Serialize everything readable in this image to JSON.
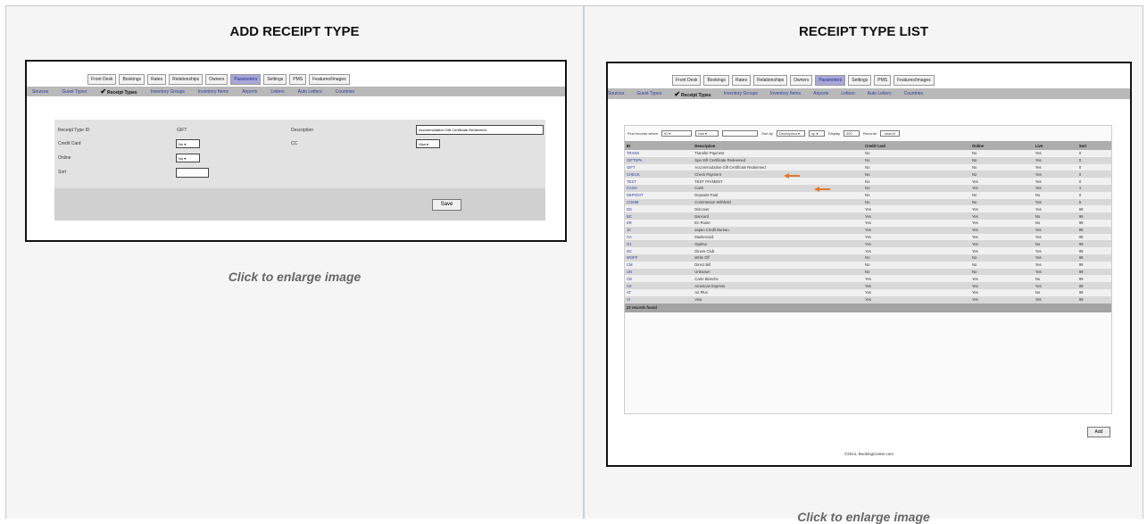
{
  "left": {
    "title": "ADD RECEIPT TYPE",
    "caption": "Click to enlarge image",
    "tabs": [
      "Front Desk",
      "Bookings",
      "Rates",
      "Relationships",
      "Owners",
      "Parameters",
      "Settings",
      "PMS",
      "Features/Images"
    ],
    "active_tab": 5,
    "subnav": [
      "Sources",
      "Guest Types",
      "Receipt Types",
      "Inventory Groups",
      "Inventory Items",
      "Airports",
      "Letters",
      "Auto Letters",
      "Countries"
    ],
    "active_sub": 2,
    "form": {
      "receipt_type_id_label": "Receipt Type ID",
      "receipt_type_id_value": "GIFT",
      "description_label": "Description",
      "description_value": "Accommodation Gift Certificate Redeemed",
      "credit_card_label": "Credit Card",
      "credit_card_value": "No",
      "cc_label": "CC",
      "cc_value": "Visa",
      "online_label": "Online",
      "online_value": "No",
      "sort_label": "Sort",
      "sort_value": "",
      "save_label": "Save"
    }
  },
  "right": {
    "title": "RECEIPT TYPE LIST",
    "caption": "Click to enlarge image",
    "filter": {
      "find_label": "Find records where",
      "field": "ID",
      "op": "has",
      "sort_label": "Sort by",
      "sort_field": "Description",
      "sort_dir": "up",
      "display_label": "Display",
      "display_value": "200",
      "records_label": "Records",
      "search_label": "search"
    },
    "columns": [
      "ID",
      "Description",
      "Credit Card",
      "Online",
      "Live",
      "Sort"
    ],
    "rows": [
      [
        "TRANS",
        "Transfer Payment",
        "No",
        "No",
        "Yes",
        "0"
      ],
      [
        "GIFTSPA",
        "Spa Gift Certificate Redeemed",
        "No",
        "No",
        "Yes",
        "0"
      ],
      [
        "GIFT",
        "Accommodation Gift Certificate Redeemed",
        "No",
        "No",
        "Yes",
        "0"
      ],
      [
        "CHECK",
        "Check Payment",
        "No",
        "No",
        "Yes",
        "0"
      ],
      [
        "TEST",
        "TEST PAYMENT",
        "No",
        "Yes",
        "Yes",
        "0"
      ],
      [
        "CASH",
        "Cash",
        "No",
        "Yes",
        "Yes",
        "1"
      ],
      [
        "DEPOSIT",
        "Deposits Paid",
        "No",
        "No",
        "No",
        "0"
      ],
      [
        "COMM",
        "Commission Withheld",
        "No",
        "No",
        "Yes",
        "5"
      ],
      [
        "DS",
        "Discover",
        "Yes",
        "Yes",
        "Yes",
        "99"
      ],
      [
        "BC",
        "Bancard",
        "Yes",
        "Yes",
        "No",
        "99"
      ],
      [
        "ER",
        "En Route",
        "Yes",
        "Yes",
        "No",
        "99"
      ],
      [
        "JC",
        "Japan Credit Bureau",
        "Yes",
        "Yes",
        "Yes",
        "99"
      ],
      [
        "CA",
        "Mastercard",
        "Yes",
        "Yes",
        "Yes",
        "99"
      ],
      [
        "O1",
        "Optima",
        "Yes",
        "Yes",
        "No",
        "99"
      ],
      [
        "DC",
        "Diners Club",
        "Yes",
        "Yes",
        "Yes",
        "99"
      ],
      [
        "WOFF",
        "Write Off",
        "No",
        "No",
        "Yes",
        "99"
      ],
      [
        "CM",
        "Direct Bill",
        "No",
        "No",
        "Yes",
        "99"
      ],
      [
        "UN",
        "Unknown",
        "No",
        "No",
        "Yes",
        "99"
      ],
      [
        "CB",
        "Carte Blanche",
        "Yes",
        "Yes",
        "No",
        "99"
      ],
      [
        "AX",
        "American Express",
        "Yes",
        "Yes",
        "Yes",
        "99"
      ],
      [
        "AT",
        "Air Plus",
        "Yes",
        "Yes",
        "No",
        "99"
      ],
      [
        "VI",
        "Visa",
        "Yes",
        "Yes",
        "Yes",
        "99"
      ]
    ],
    "footer": "22 records found",
    "add_label": "Add",
    "copyright": "©2014, BookingCenter.com",
    "highlighted_rows": [
      1,
      2
    ],
    "arrow_color": "#e07a30"
  }
}
